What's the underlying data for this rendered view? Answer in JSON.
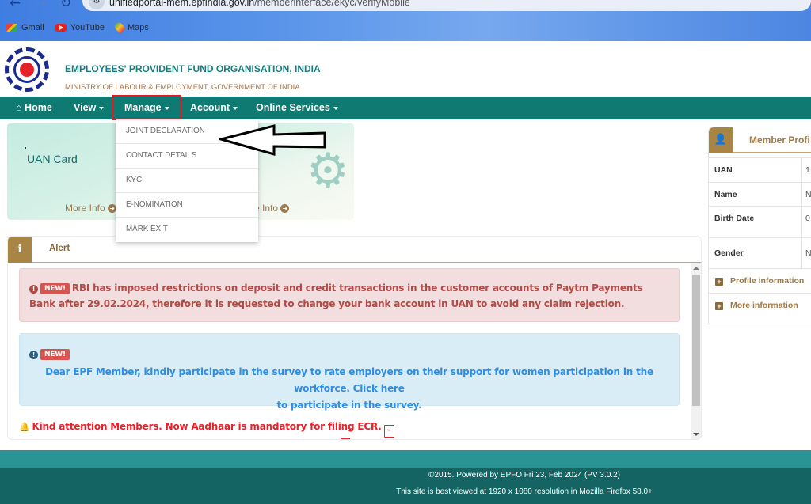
{
  "browser": {
    "url_domain": "unifiedportal-mem.epfindia.gov.in",
    "url_path": "/memberinterface/ekyc/verifyMobile",
    "bookmarks": [
      {
        "label": "Gmail",
        "icon": "gmail-icon"
      },
      {
        "label": "YouTube",
        "icon": "youtube-icon"
      },
      {
        "label": "Maps",
        "icon": "maps-icon"
      }
    ]
  },
  "header": {
    "org_name": "EMPLOYEES' PROVIDENT FUND ORGANISATION, INDIA",
    "ministry": "MINISTRY OF LABOUR & EMPLOYMENT, GOVERNMENT OF INDIA"
  },
  "navbar": {
    "items": [
      {
        "label": "Home",
        "icon": "home-icon"
      },
      {
        "label": "View"
      },
      {
        "label": "Manage"
      },
      {
        "label": "Account"
      },
      {
        "label": "Online Services"
      }
    ]
  },
  "manage_dropdown": {
    "items": [
      "JOINT DECLARATION",
      "CONTACT DETAILS",
      "KYC",
      "E-NOMINATION",
      "MARK EXIT"
    ]
  },
  "cards": {
    "uan_card_title": "UAN Card",
    "more_info_1": "More Info",
    "more_info_2": "re Info"
  },
  "member_profile": {
    "title": "Member Profi",
    "rows": [
      {
        "label": "UAN",
        "value": "1"
      },
      {
        "label": "Name",
        "value": "N"
      },
      {
        "label": "Birth Date",
        "value": "0"
      },
      {
        "label": "Gender",
        "value": "N"
      }
    ],
    "accordions": [
      "Profile information",
      "More information"
    ]
  },
  "alert": {
    "title": "Alert",
    "badge": "NEW!",
    "red_message": "RBI has imposed restrictions on deposit and credit transactions in the customer accounts of Paytm Payments Bank after 29.02.2024, therefore it is requested to change your bank account in UAN to avoid any claim rejection.",
    "blue_message_line1": "Dear EPF Member, kindly participate in the survey to rate employers on their support for women participation in the workforce. Click here",
    "blue_message_line2": "to participate in the survey.",
    "notice": "Kind attention Members. Now Aadhaar is mandatory for filing ECR."
  },
  "footer": {
    "line1": "©2015. Powered by EPFO Fri 23, Feb 2024 (PV 3.0.2)",
    "line2": "This site is best viewed at 1920 x 1080 resolution in Mozilla Firefox 58.0+"
  },
  "colors": {
    "navbar": "#0e7a72",
    "accent_gold": "#a98545",
    "alert_red": "#b24a46",
    "alert_blue": "#2f8de4",
    "footer": "#146464"
  }
}
